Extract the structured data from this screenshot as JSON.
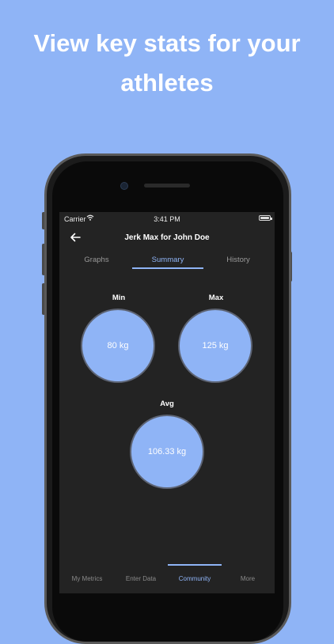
{
  "headline": [
    "View key stats for your",
    "athletes"
  ],
  "status_bar": {
    "carrier": "Carrier",
    "time": "3:41 PM"
  },
  "header": {
    "title": "Jerk Max for John Doe"
  },
  "tabs": [
    {
      "label": "Graphs",
      "active": false
    },
    {
      "label": "Summary",
      "active": true
    },
    {
      "label": "History",
      "active": false
    }
  ],
  "stats": {
    "min": {
      "label": "Min",
      "value": "80 kg"
    },
    "max": {
      "label": "Max",
      "value": "125 kg"
    },
    "avg": {
      "label": "Avg",
      "value": "106.33 kg"
    }
  },
  "bottom_nav": [
    {
      "label": "My Metrics",
      "active": false
    },
    {
      "label": "Enter Data",
      "active": false
    },
    {
      "label": "Community",
      "active": true
    },
    {
      "label": "More",
      "active": false
    }
  ],
  "colors": {
    "accent": "#8fb4f6",
    "background": "#8fb4f6",
    "screen": "#232323"
  },
  "icons": {
    "back": "arrow-left-icon",
    "wifi": "wifi-icon",
    "battery": "battery-icon"
  }
}
